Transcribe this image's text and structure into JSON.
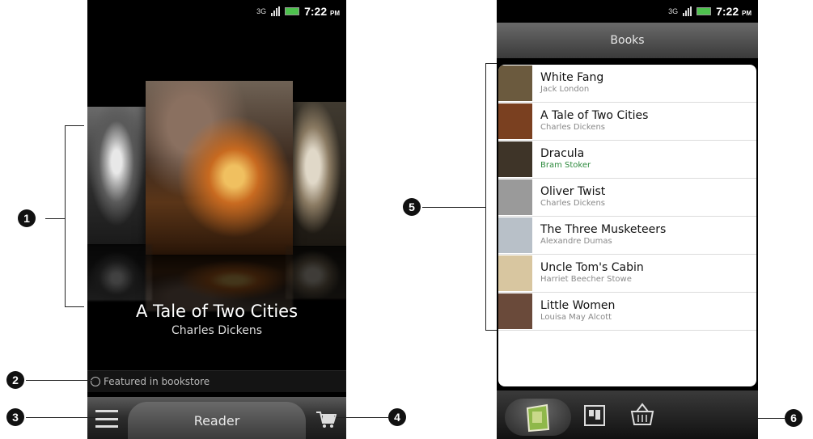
{
  "left_phone": {
    "status": {
      "network": "3G",
      "time": "7:22",
      "ampm": "PM"
    },
    "featured_book": {
      "title": "A Tale of Two Cities",
      "author": "Charles Dickens"
    },
    "featured_label": "Featured in bookstore",
    "tab_label": "Reader",
    "icons": {
      "menu": "menu-icon",
      "cart": "cart-icon"
    }
  },
  "right_phone": {
    "status": {
      "network": "3G",
      "time": "7:22",
      "ampm": "PM"
    },
    "title": "Books",
    "books": [
      {
        "title": "White Fang",
        "author": "Jack London",
        "thumb": "#6b5a3e"
      },
      {
        "title": "A Tale of Two Cities",
        "author": "Charles Dickens",
        "thumb": "#7a4020"
      },
      {
        "title": "Dracula",
        "author": "Bram Stoker",
        "thumb": "#3e3428"
      },
      {
        "title": "Oliver Twist",
        "author": "Charles Dickens",
        "thumb": "#9a9a9a"
      },
      {
        "title": "The Three Musketeers",
        "author": "Alexandre Dumas",
        "thumb": "#b8c0c8"
      },
      {
        "title": "Uncle Tom's Cabin",
        "author": "Harriet Beecher Stowe",
        "thumb": "#d8c6a0"
      },
      {
        "title": "Little Women",
        "author": "Louisa May Alcott",
        "thumb": "#6a4a3a"
      }
    ],
    "dock_icons": [
      "library-icon",
      "downloads-icon",
      "bookstore-icon"
    ]
  },
  "callouts": [
    "1",
    "2",
    "3",
    "4",
    "5",
    "6"
  ],
  "colors": {
    "battery": "#4ec24e",
    "author_green": "#2e8b3e"
  }
}
